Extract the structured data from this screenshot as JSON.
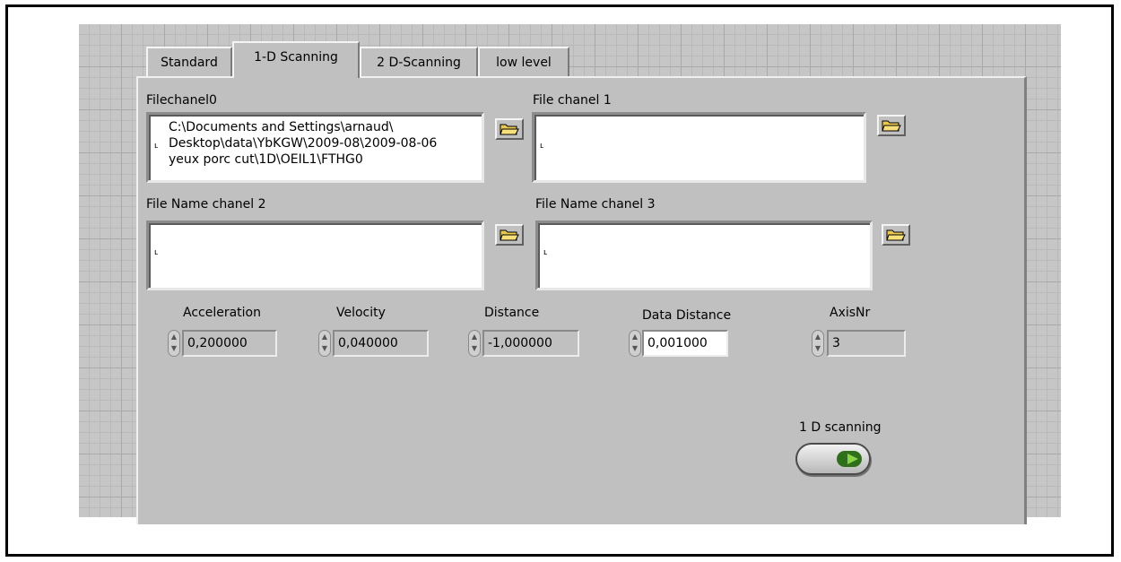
{
  "tabs": [
    {
      "label": "Standard",
      "active": false
    },
    {
      "label": "1-D Scanning",
      "active": true
    },
    {
      "label": "2 D-Scanning",
      "active": false
    },
    {
      "label": "low level",
      "active": false
    }
  ],
  "files": {
    "ch0": {
      "label": "Filechanel0",
      "value": "C:\\Documents and Settings\\arnaud\\\nDesktop\\data\\YbKGW\\2009-08\\2009-08-06\nyeux porc cut\\1D\\OEIL1\\FTHG0"
    },
    "ch1": {
      "label": "File chanel 1",
      "value": ""
    },
    "ch2": {
      "label": "File Name chanel 2",
      "value": ""
    },
    "ch3": {
      "label": "File Name chanel 3",
      "value": ""
    }
  },
  "numerics": {
    "acceleration": {
      "label": "Acceleration",
      "value": "0,200000"
    },
    "velocity": {
      "label": "Velocity",
      "value": "0,040000"
    },
    "distance": {
      "label": "Distance",
      "value": "-1,000000"
    },
    "data_distance": {
      "label": "Data Distance",
      "value": "0,001000"
    },
    "axis_nr": {
      "label": "AxisNr",
      "value": "3"
    }
  },
  "scan_button": {
    "label": "1 D scanning"
  },
  "icons": {
    "browse": "folder-open-icon",
    "path": "path-symbol-icon",
    "spinner": "increment-decrement-icon"
  },
  "colors": {
    "panel": "#c0c0c0",
    "led_on": "#88d448",
    "led_body": "#2f6f1c"
  }
}
